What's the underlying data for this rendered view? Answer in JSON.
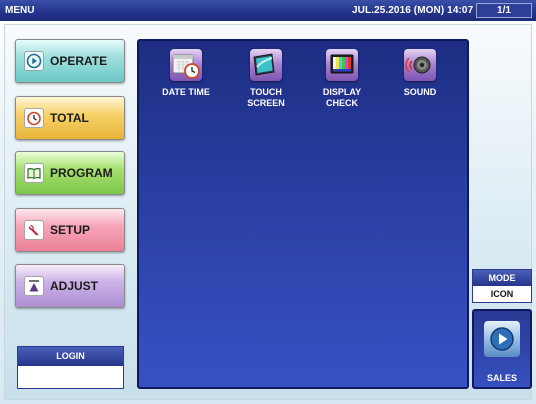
{
  "titlebar": {
    "title": "MENU",
    "datetime": "JUL.25.2016 (MON)  14:07",
    "page_indicator": "1/1"
  },
  "sidebar": {
    "items": [
      {
        "label": "OPERATE",
        "icon": "play-circle-icon"
      },
      {
        "label": "TOTAL",
        "icon": "clock-icon"
      },
      {
        "label": "PROGRAM",
        "icon": "book-icon"
      },
      {
        "label": "SETUP",
        "icon": "wrench-icon"
      },
      {
        "label": "ADJUST",
        "icon": "scale-icon"
      }
    ]
  },
  "login": {
    "label": "LOGIN",
    "value": ""
  },
  "main": {
    "items": [
      {
        "label": "DATE TIME",
        "icon": "calendar-clock-icon"
      },
      {
        "label": "TOUCH\nSCREEN",
        "icon": "touch-screen-icon"
      },
      {
        "label": "DISPLAY\nCHECK",
        "icon": "display-check-icon"
      },
      {
        "label": "SOUND",
        "icon": "speaker-icon"
      }
    ]
  },
  "mode": {
    "label": "MODE",
    "value": "ICON"
  },
  "sales": {
    "label": "SALES",
    "icon": "sales-play-icon"
  },
  "colors": {
    "titlebar": "#23338a",
    "panel": "#2a3fa2",
    "operate": "#9fe0de",
    "total": "#f7d36a",
    "program": "#a8e070",
    "setup": "#f6a6b8",
    "adjust": "#cbb2e6"
  }
}
